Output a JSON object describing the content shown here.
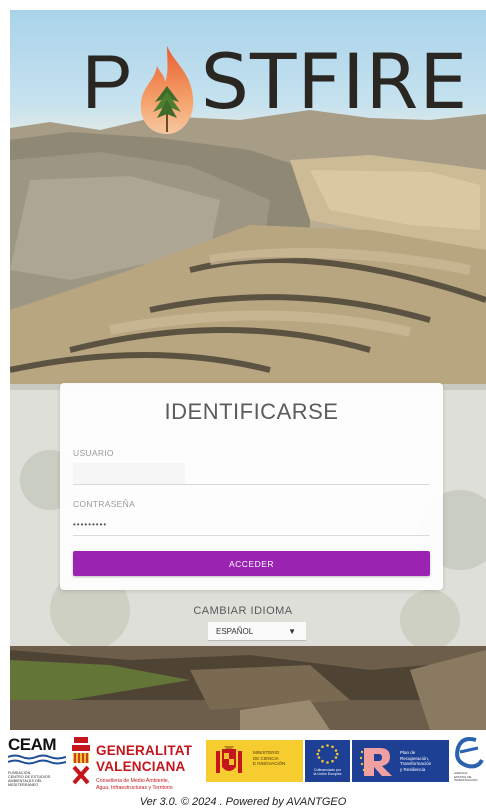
{
  "app": {
    "logo_text": "STFIRE",
    "logo_first_letter": "P"
  },
  "login": {
    "title": "IDENTIFICARSE",
    "user_label": "USUARIO",
    "user_value": "",
    "password_label": "CONTRASEÑA",
    "password_value": "•••••••••",
    "submit_label": "ACCEDER"
  },
  "language": {
    "title": "CAMBIAR IDIOMA",
    "selected": "ESPAÑOL"
  },
  "footer": {
    "ceam": {
      "name": "CEAM",
      "sub": [
        "FUNDACIÓN",
        "CENTRO DE ESTUDIOS",
        "AMBIENTALES DEL",
        "MEDITERRÁNEO"
      ]
    },
    "generalitat": {
      "name_line1": "GENERALITAT",
      "name_line2": "VALENCIANA",
      "sub_line1": "Conselleria de Medio Ambiente,",
      "sub_line2": "Agua, Infraestructuras y Territorio"
    },
    "ministerio": {
      "lines": [
        "MINISTERIO",
        "DE CIENCIA",
        "E INNOVACIÓN"
      ]
    },
    "eu": {
      "lines": [
        "Cofinanciado por",
        "la Unión Europea"
      ]
    },
    "plan": {
      "lines": [
        "Plan de",
        "Recuperación,",
        "Transformación",
        "y Resiliencia"
      ]
    },
    "aei": {
      "lines": [
        "AGENCIA",
        "ESTATAL DE",
        "INVESTIGACIÓN"
      ]
    },
    "version": "Ver 3.0. © 2024 . Powered by AVANTGEO"
  },
  "colors": {
    "primary_button": "#9a23b2",
    "gv_red": "#c4161c",
    "ministerio_yellow": "#f7cc2e",
    "eu_blue": "#1d3f94"
  }
}
